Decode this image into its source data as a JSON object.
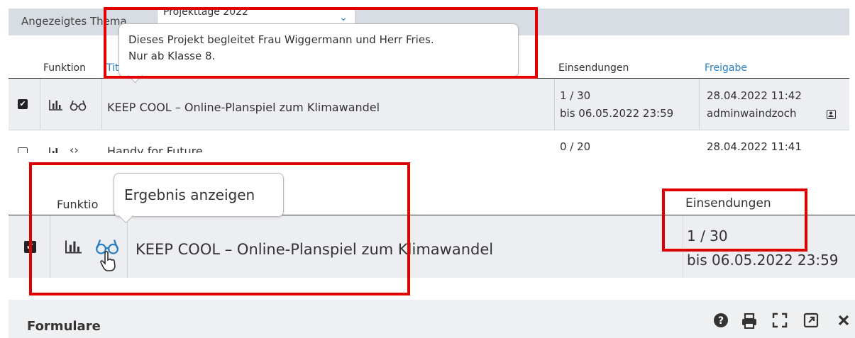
{
  "topbar": {
    "label": "Angezeigtes Thema",
    "select_value": "Projekttage 2022"
  },
  "table_top": {
    "columns": {
      "function": "Funktion",
      "title": "Tit",
      "submissions": "Einsendungen",
      "release": "Freigabe"
    },
    "rows": [
      {
        "checked": true,
        "title": "KEEP COOL – Online-Planspiel zum Klimawandel",
        "submissions": "1 / 30",
        "deadline": "bis 06.05.2022 23:59",
        "release_date": "28.04.2022 11:42",
        "release_user": "adminwaindzoch"
      },
      {
        "checked": false,
        "title": "Handy for Future",
        "submissions": "0 / 20",
        "release_date": "28.04.2022 11:41"
      }
    ]
  },
  "tooltip_top": {
    "line1": "Dieses Projekt begleitet Frau Wiggermann und Herr Fries.",
    "line2": "Nur ab Klasse 8."
  },
  "zoom": {
    "columns": {
      "function": "Funktio",
      "submissions": "Einsendungen"
    },
    "tooltip": "Ergebnis anzeigen",
    "row": {
      "title": "KEEP COOL – Online-Planspiel zum Klimawandel",
      "submissions": "1 / 30",
      "deadline": "bis 06.05.2022 23:59"
    }
  },
  "footer": {
    "title": "Formulare"
  },
  "icons": {
    "stats": "bar-chart-icon",
    "view": "glasses-icon",
    "help": "help-icon",
    "print": "print-icon",
    "expand": "expand-icon",
    "popout": "popout-icon",
    "close": "close-icon"
  },
  "colors": {
    "accent": "#2a7fc2",
    "highlight": "#e00000"
  }
}
